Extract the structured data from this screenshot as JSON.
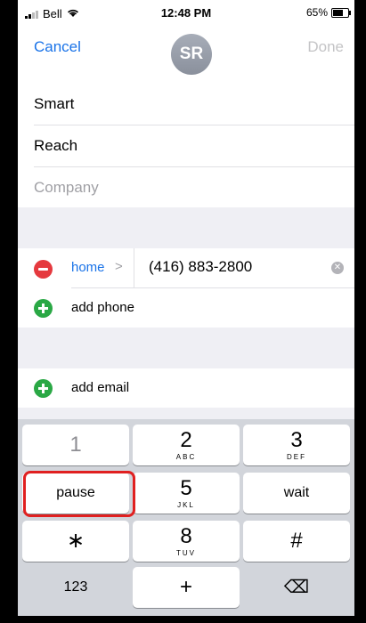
{
  "status_bar": {
    "carrier": "Bell",
    "time": "12:48 PM",
    "battery": "65%"
  },
  "nav": {
    "cancel": "Cancel",
    "avatar_initials": "SR",
    "done": "Done"
  },
  "name_fields": {
    "first": "Smart",
    "last": "Reach",
    "company_placeholder": "Company"
  },
  "phone": {
    "label": "home",
    "chevron": ">",
    "number": "(416) 883-2800"
  },
  "add_phone": "add phone",
  "add_email": "add email",
  "keypad": {
    "keys": [
      {
        "main": "1",
        "sub": ""
      },
      {
        "main": "2",
        "sub": "ABC"
      },
      {
        "main": "3",
        "sub": "DEF"
      },
      {
        "main": "pause",
        "sub": ""
      },
      {
        "main": "5",
        "sub": "JKL"
      },
      {
        "main": "wait",
        "sub": ""
      },
      {
        "main": "∗",
        "sub": ""
      },
      {
        "main": "8",
        "sub": "TUV"
      },
      {
        "main": "#",
        "sub": ""
      },
      {
        "main": "123",
        "sub": ""
      },
      {
        "main": "+",
        "sub": ""
      },
      {
        "main": "⌫",
        "sub": ""
      }
    ]
  },
  "colors": {
    "accent": "#1a73e8",
    "delete": "#e5393e",
    "add": "#2aa845",
    "highlight": "#e02020"
  }
}
